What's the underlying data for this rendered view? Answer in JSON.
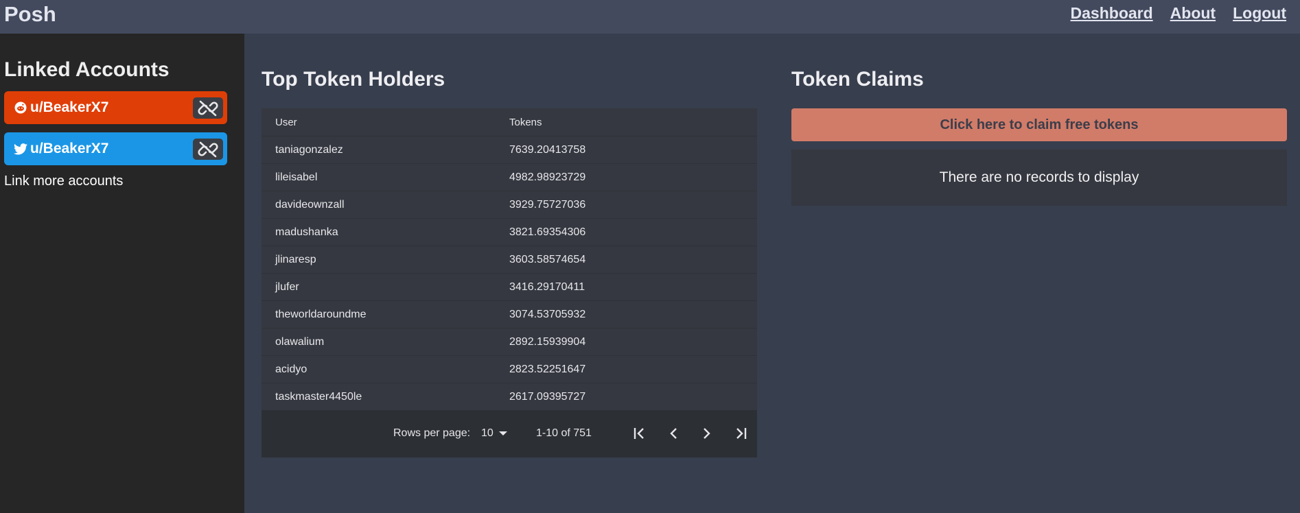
{
  "header": {
    "brand": "Posh",
    "nav": [
      "Dashboard",
      "About",
      "Logout"
    ]
  },
  "sidebar": {
    "title": "Linked Accounts",
    "accounts": [
      {
        "service": "reddit",
        "username": "u/BeakerX7",
        "color": "#e03e07",
        "icon": "reddit-icon"
      },
      {
        "service": "twitter",
        "username": "u/BeakerX7",
        "color": "#1b96e6",
        "icon": "twitter-icon"
      }
    ],
    "link_more": "Link more accounts"
  },
  "holders": {
    "title": "Top Token Holders",
    "columns": [
      "User",
      "Tokens"
    ],
    "rows": [
      {
        "user": "taniagonzalez",
        "tokens": "7639.20413758"
      },
      {
        "user": "lileisabel",
        "tokens": "4982.98923729"
      },
      {
        "user": "davideownzall",
        "tokens": "3929.75727036"
      },
      {
        "user": "madushanka",
        "tokens": "3821.69354306"
      },
      {
        "user": "jlinaresp",
        "tokens": "3603.58574654"
      },
      {
        "user": "jlufer",
        "tokens": "3416.29170411"
      },
      {
        "user": "theworldaroundme",
        "tokens": "3074.53705932"
      },
      {
        "user": "olawalium",
        "tokens": "2892.15939904"
      },
      {
        "user": "acidyo",
        "tokens": "2823.52251647"
      },
      {
        "user": "taskmaster4450le",
        "tokens": "2617.09395727"
      }
    ],
    "pagination": {
      "rows_per_page_label": "Rows per page:",
      "rows_per_page": "10",
      "range": "1-10 of 751"
    }
  },
  "claims": {
    "title": "Token Claims",
    "button": "Click here to claim free tokens",
    "empty": "There are no records to display"
  },
  "colors": {
    "topbar": "#434a5e",
    "sidebar": "#262626",
    "main": "#373e4d",
    "claim_button": "#d17b69"
  }
}
